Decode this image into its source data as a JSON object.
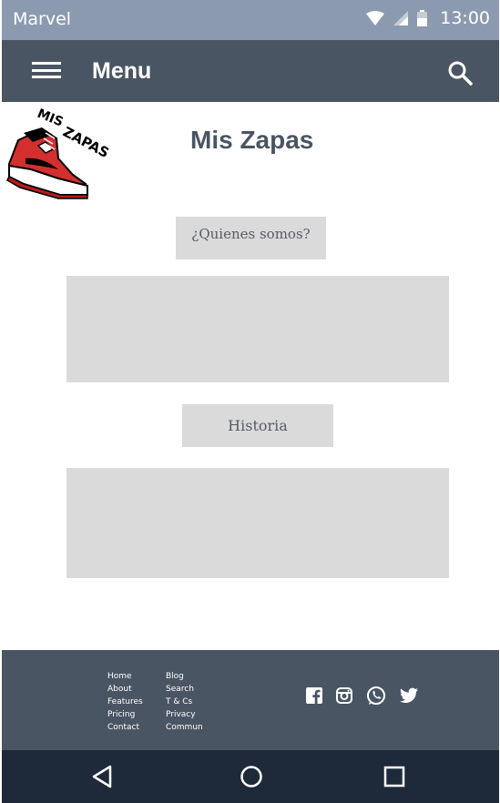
{
  "status_bar": {
    "carrier": "Marvel",
    "time": "13:00"
  },
  "app_bar": {
    "title": "Menu"
  },
  "header": {
    "logo_text": "MIS ZAPAS",
    "title": "Mis Zapas"
  },
  "sections": {
    "about_button": "¿Quienes somos?",
    "history_button": "Historia"
  },
  "footer": {
    "col1": [
      "Home",
      "About",
      "Features",
      "Pricing",
      "Contact"
    ],
    "col2": [
      "Blog",
      "Search",
      "T & Cs",
      "Privacy",
      "Commun"
    ]
  },
  "colors": {
    "status_bar": "#8c9ab0",
    "app_bar": "#4a5563",
    "footer": "#4a5563",
    "nav_bar": "#1e2a3a",
    "placeholder": "#dadada",
    "title": "#4a5563"
  }
}
